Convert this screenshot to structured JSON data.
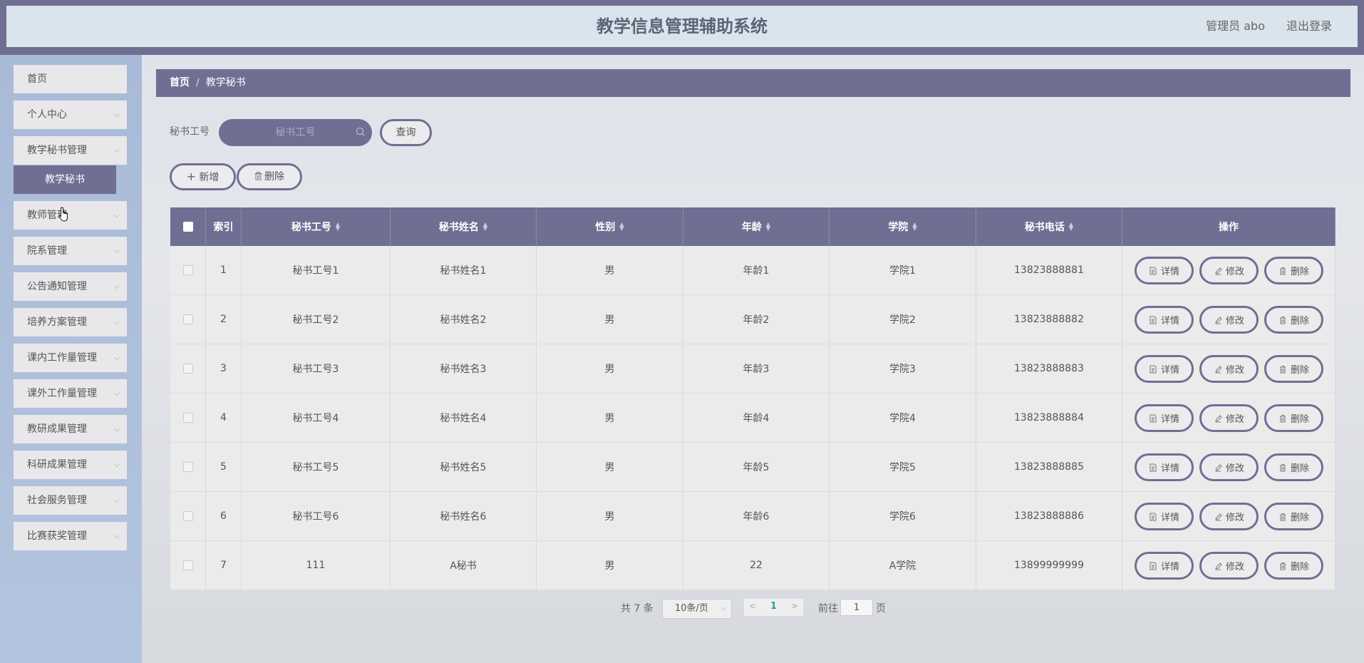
{
  "header": {
    "title": "教学信息管理辅助系统",
    "user": "管理员 abo",
    "logout": "退出登录"
  },
  "sidebar": {
    "items": [
      {
        "label": "首页",
        "has_arrow": false
      },
      {
        "label": "个人中心",
        "has_arrow": true
      },
      {
        "label": "教学秘书管理",
        "has_arrow": true
      },
      {
        "label": "教师管理",
        "has_arrow": true
      },
      {
        "label": "院系管理",
        "has_arrow": true
      },
      {
        "label": "公告通知管理",
        "has_arrow": true
      },
      {
        "label": "培养方案管理",
        "has_arrow": true
      },
      {
        "label": "课内工作量管理",
        "has_arrow": true
      },
      {
        "label": "课外工作量管理",
        "has_arrow": true
      },
      {
        "label": "教研成果管理",
        "has_arrow": true
      },
      {
        "label": "科研成果管理",
        "has_arrow": true
      },
      {
        "label": "社会服务管理",
        "has_arrow": true
      },
      {
        "label": "比赛获奖管理",
        "has_arrow": true
      }
    ],
    "active_sub": "教学秘书"
  },
  "breadcrumb": {
    "home": "首页",
    "sep": "/",
    "current": "教学秘书"
  },
  "search": {
    "label": "秘书工号",
    "placeholder": "秘书工号",
    "button": "查询"
  },
  "actions": {
    "add": "新增",
    "delete": "删除"
  },
  "table": {
    "columns": [
      "索引",
      "秘书工号",
      "秘书姓名",
      "性别",
      "年龄",
      "学院",
      "秘书电话",
      "操作"
    ],
    "rows": [
      [
        "1",
        "秘书工号1",
        "秘书姓名1",
        "男",
        "年龄1",
        "学院1",
        "13823888881"
      ],
      [
        "2",
        "秘书工号2",
        "秘书姓名2",
        "男",
        "年龄2",
        "学院2",
        "13823888882"
      ],
      [
        "3",
        "秘书工号3",
        "秘书姓名3",
        "男",
        "年龄3",
        "学院3",
        "13823888883"
      ],
      [
        "4",
        "秘书工号4",
        "秘书姓名4",
        "男",
        "年龄4",
        "学院4",
        "13823888884"
      ],
      [
        "5",
        "秘书工号5",
        "秘书姓名5",
        "男",
        "年龄5",
        "学院5",
        "13823888885"
      ],
      [
        "6",
        "秘书工号6",
        "秘书姓名6",
        "男",
        "年龄6",
        "学院6",
        "13823888886"
      ],
      [
        "7",
        "111",
        "A秘书",
        "男",
        "22",
        "A学院",
        "13899999999"
      ]
    ],
    "row_actions": {
      "detail": "详情",
      "edit": "修改",
      "delete": "删除"
    }
  },
  "pagination": {
    "total": "共 7 条",
    "page_size": "10条/页",
    "current_page": "1",
    "goto_label": "前往",
    "goto_value": "1",
    "page_suffix": "页"
  },
  "colors": {
    "accent": "#6f6f93",
    "header_bg": "#dae4ec",
    "sidebar_bg": "#a9bad8",
    "current_page": "#2a9d8f"
  }
}
